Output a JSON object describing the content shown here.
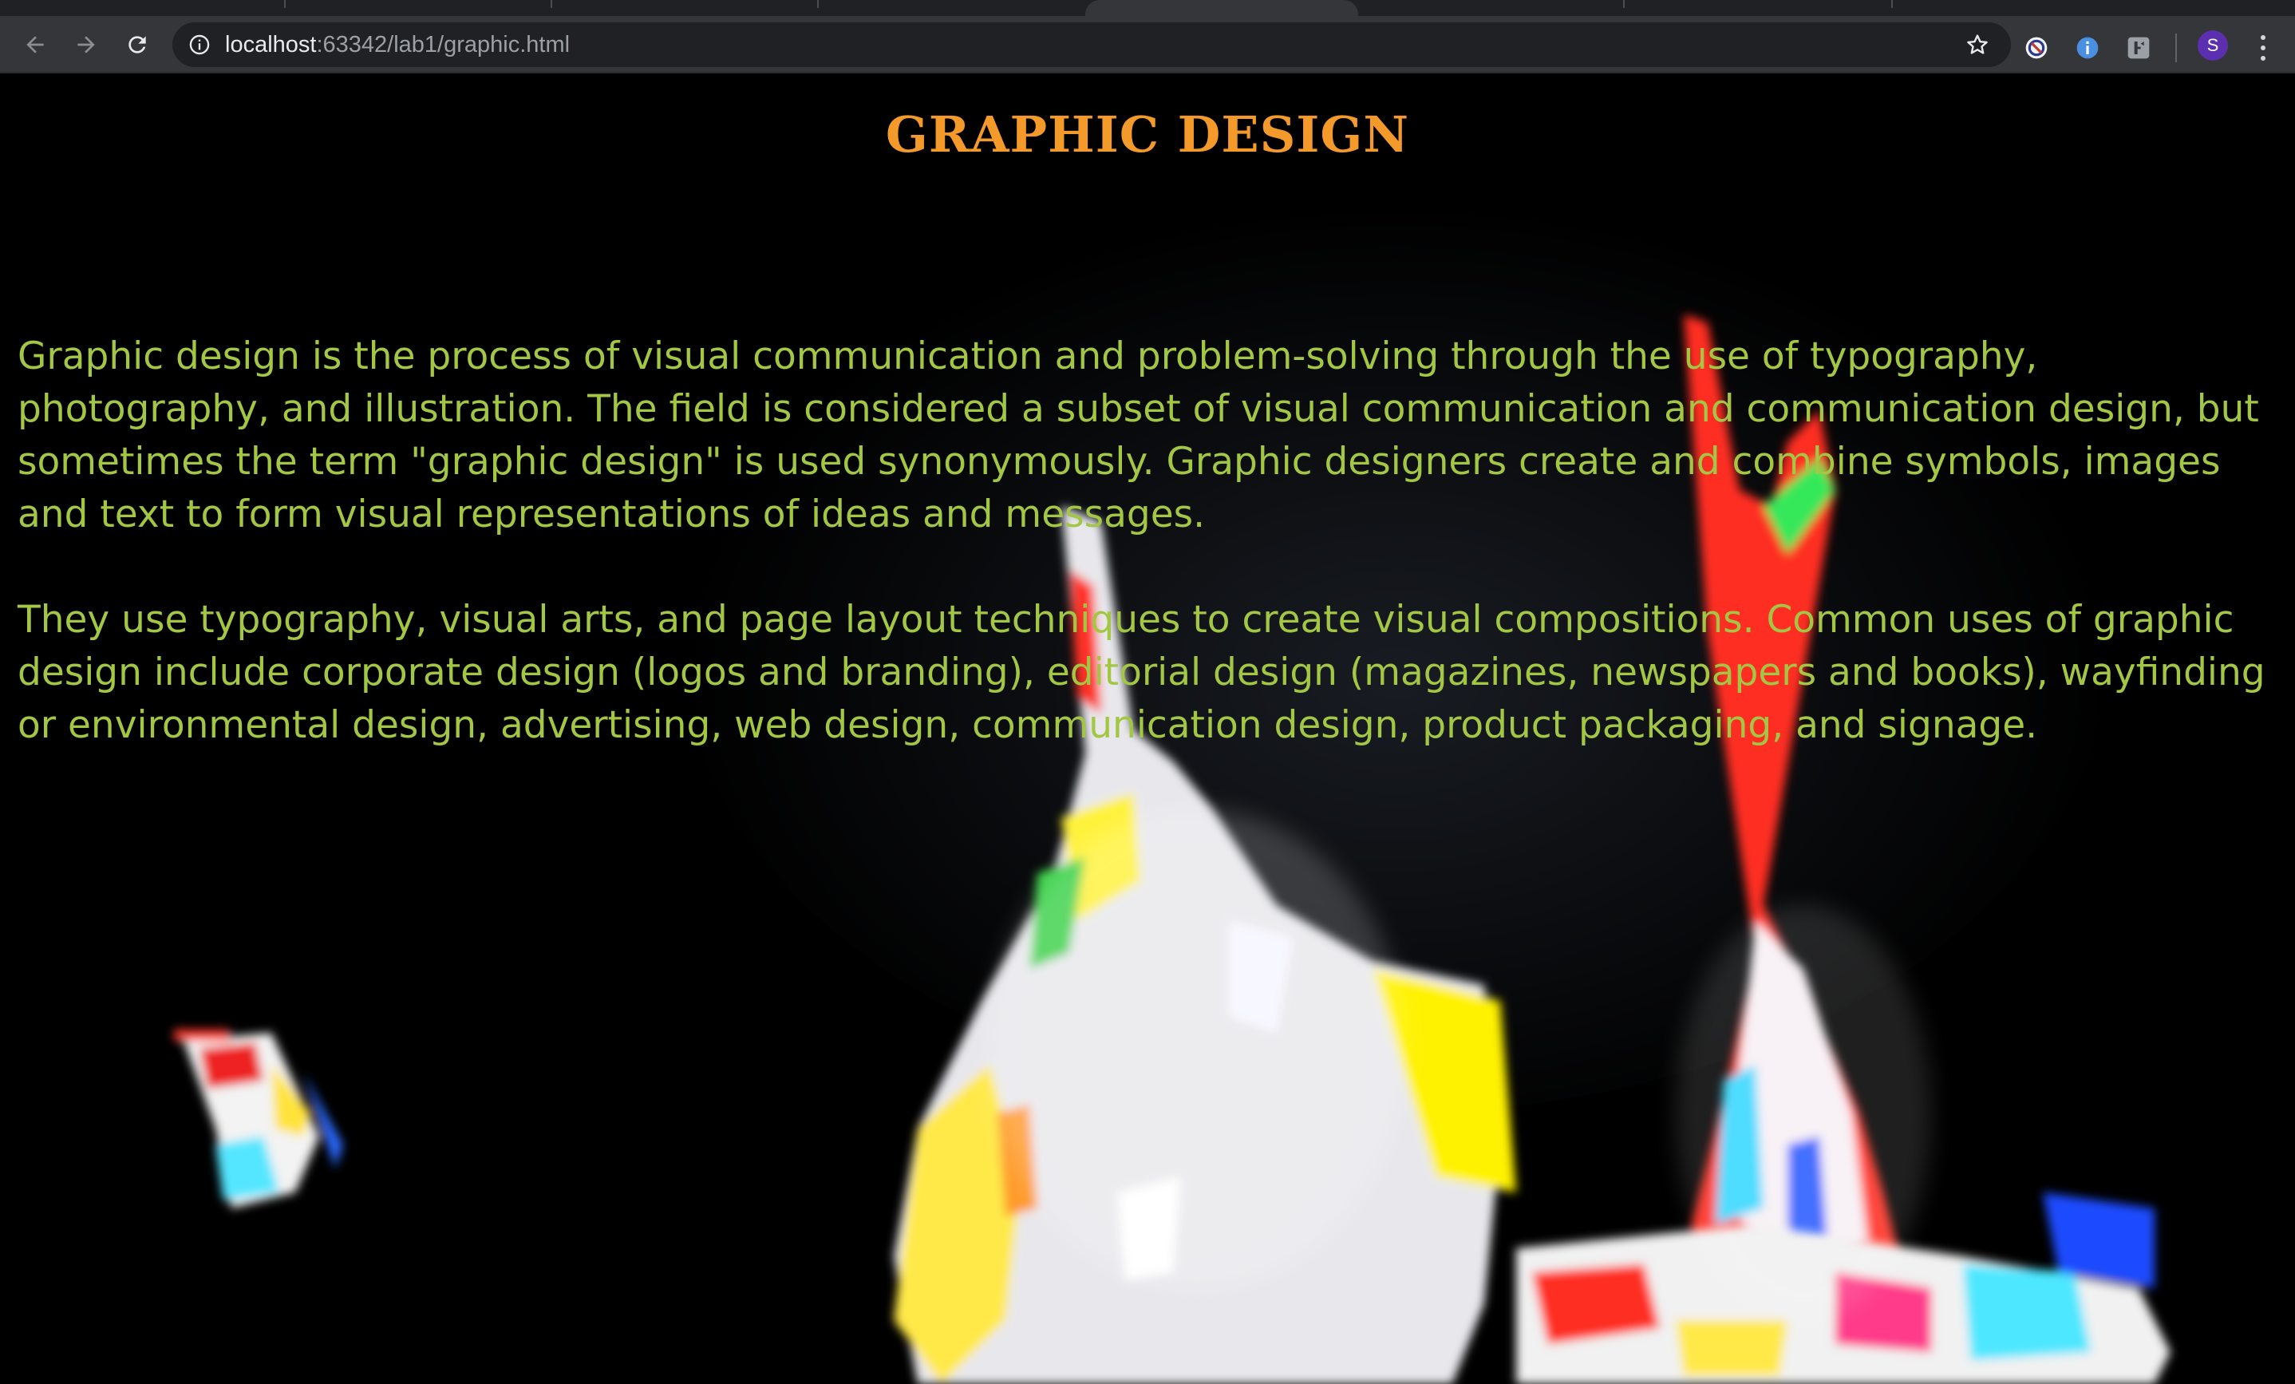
{
  "browser": {
    "url_host": "localhost",
    "url_rest": ":63342/lab1/graphic.html",
    "profile_initial": "S",
    "toolbar_icons": [
      "back-arrow-icon",
      "forward-arrow-icon",
      "reload-icon",
      "info-icon",
      "star-icon",
      "block-extension-icon",
      "info-extension-icon",
      "extension-icon",
      "avatar",
      "kebab-menu-icon"
    ]
  },
  "page": {
    "title": "GRAPHIC DESIGN",
    "paragraphs": [
      "Graphic design is the process of visual communication and problem-solving through the use of typography, photography, and illustration. The field is considered a subset of visual communication and communication design, but sometimes the term \"graphic design\" is used synonymously. Graphic designers create and combine symbols, images and text to form visual representations of ideas and messages.",
      "They use typography, visual arts, and page layout techniques to create visual compositions. Common uses of graphic design include corporate design (logos and branding), editorial design (magazines, newspapers and books), wayfinding or environmental design, advertising, web design, communication design, product packaging, and signage."
    ]
  },
  "colors": {
    "title": "#f39a2a",
    "body_text": "#a3c644",
    "page_background": "#000000",
    "toolbar": "#35363a",
    "omnibox": "#202124"
  }
}
